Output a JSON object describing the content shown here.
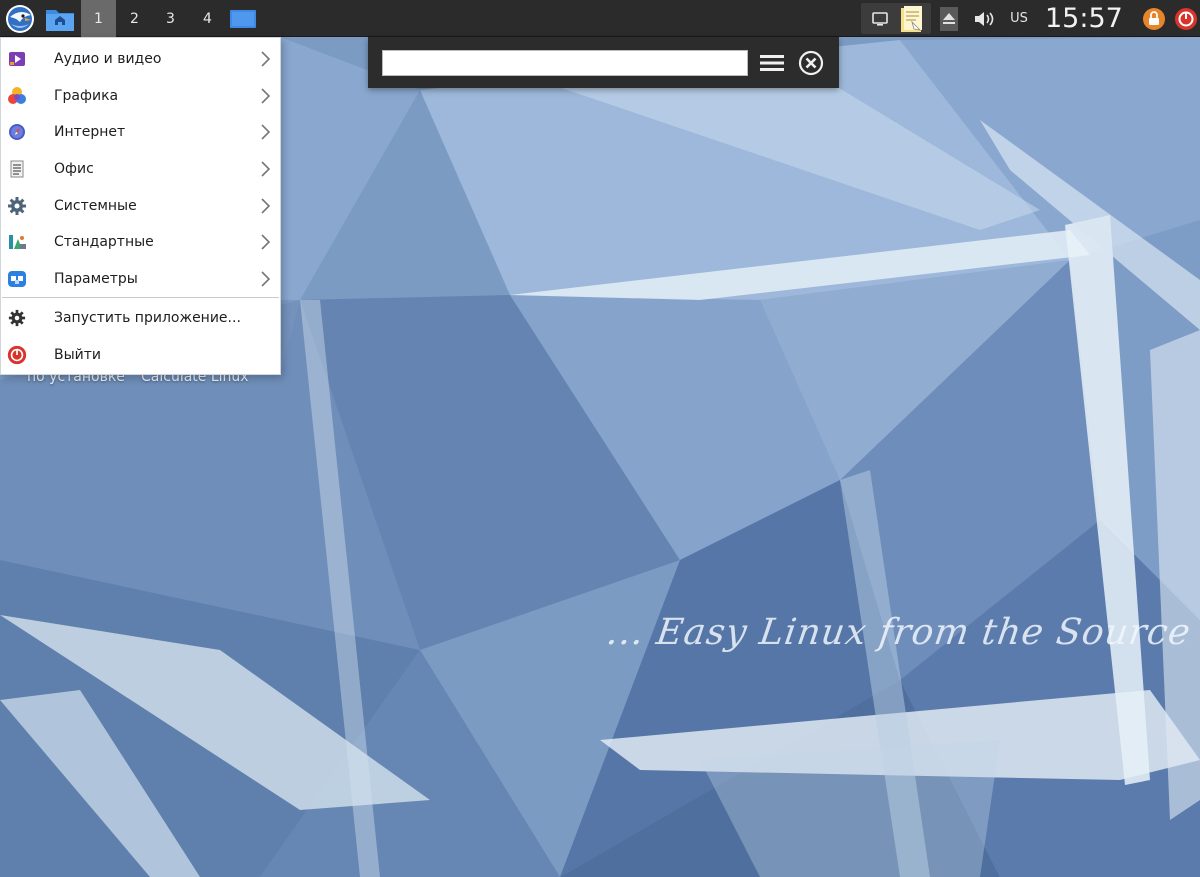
{
  "panel": {
    "workspaces": [
      "1",
      "2",
      "3",
      "4"
    ],
    "active_workspace": "1",
    "keyboard_layout": "US",
    "clock": "15:57",
    "icons": {
      "start": "calculate-linux-logo-icon",
      "home": "home-folder-icon",
      "desktop": "show-desktop-icon",
      "tray1": "window-icon",
      "tray2": "clipboard-notes-icon",
      "eject": "eject-icon",
      "volume": "volume-icon",
      "lock": "lock-icon",
      "power": "power-icon"
    }
  },
  "app_menu": {
    "items": [
      {
        "label": "Аудио и видео",
        "icon": "multimedia-icon",
        "submenu": true
      },
      {
        "label": "Графика",
        "icon": "graphics-icon",
        "submenu": true
      },
      {
        "label": "Интернет",
        "icon": "internet-icon",
        "submenu": true
      },
      {
        "label": "Офис",
        "icon": "office-icon",
        "submenu": true
      },
      {
        "label": "Системные",
        "icon": "system-gear-icon",
        "submenu": true
      },
      {
        "label": "Стандартные",
        "icon": "accessories-icon",
        "submenu": true
      },
      {
        "label": "Параметры",
        "icon": "settings-icon",
        "submenu": true
      }
    ],
    "run_label": "Запустить приложение...",
    "logout_label": "Выйти"
  },
  "run_bar": {
    "value": "",
    "placeholder": "",
    "icons": {
      "menu": "hamburger-menu-icon",
      "close": "close-circle-icon"
    }
  },
  "desktop": {
    "labels": [
      "по установке",
      "Calculate Linux"
    ],
    "tagline": "... Easy Linux from the Source"
  },
  "colors": {
    "panel_bg": "#2b2b2b",
    "active_workspace": "#6a6a6a",
    "wallpaper_base": "#7d9cc4",
    "power_red": "#d9342b",
    "lock_orange": "#e8842a"
  }
}
